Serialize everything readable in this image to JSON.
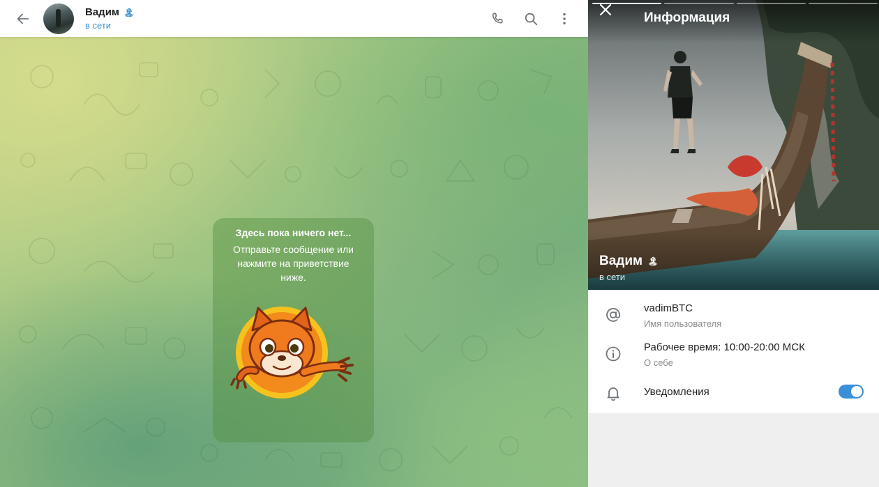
{
  "chat": {
    "name": "Вадим",
    "name_emoji": "🏝",
    "status": "в сети",
    "empty_title": "Здесь пока ничего нет...",
    "empty_text": "Отправьте сообщение или нажмите на приветствие ниже."
  },
  "header_icons": [
    "back-arrow-icon",
    "phone-icon",
    "search-icon",
    "more-vertical-icon"
  ],
  "panel": {
    "title": "Информация",
    "photo_name": "Вадим",
    "photo_name_emoji": "🏝",
    "photo_status": "в сети",
    "photo_count": 4,
    "active_photo": 1,
    "username": "vadimBTC",
    "username_label": "Имя пользователя",
    "bio": "Рабочее время: 10:00-20:00 МСК",
    "bio_label": "О себе",
    "notifications_label": "Уведомления",
    "notifications_enabled": true
  },
  "colors": {
    "accent": "#3a8fd6",
    "header_bg": "#ffffff",
    "panel_bg": "#efefef"
  }
}
